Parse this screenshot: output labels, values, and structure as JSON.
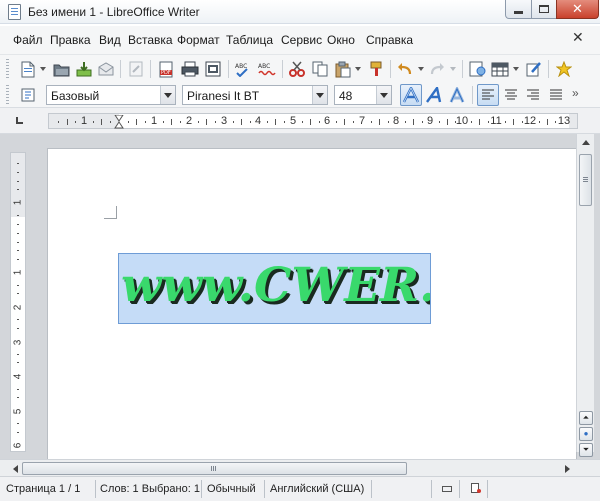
{
  "window": {
    "title": "Без имени 1 - LibreOffice Writer",
    "minimize_icon": "minimize-icon",
    "maximize_icon": "maximize-icon",
    "close_icon": "close-icon"
  },
  "menubar": {
    "items": [
      "Файл",
      "Правка",
      "Вид",
      "Вставка",
      "Формат",
      "Таблица",
      "Сервис",
      "Окно",
      "Справка"
    ],
    "close_doc": "✕"
  },
  "toolbar_standard": {
    "icons": [
      "new-document-icon",
      "open-icon",
      "save-icon",
      "email-icon",
      "edit-file-icon",
      "export-pdf-icon",
      "print-icon",
      "print-preview-icon",
      "spellcheck-icon",
      "autospellcheck-icon",
      "cut-icon",
      "copy-icon",
      "paste-icon",
      "clone-formatting-icon",
      "undo-icon",
      "redo-icon",
      "navigator-icon",
      "table-icon",
      "draw-functions-icon",
      "gallery-icon"
    ]
  },
  "toolbar_formatting": {
    "paragraph_style": "Базовый",
    "font_name": "Piranesi It BT",
    "font_size": "48",
    "icons": [
      "fontwork-outline-icon",
      "fontwork-italic-icon",
      "fontwork-shadow-icon",
      "align-left-icon",
      "align-center-icon",
      "align-right-icon",
      "justify-icon"
    ]
  },
  "ruler": {
    "labels": [
      "1",
      "1",
      "2",
      "3",
      "4",
      "5",
      "6",
      "7",
      "8",
      "9",
      "10",
      "11",
      "12",
      "13"
    ],
    "vlabels": [
      "1",
      "1",
      "2",
      "3",
      "4",
      "5",
      "6"
    ]
  },
  "document": {
    "text": "www.CWER.ws",
    "text_color": "#39d96c",
    "selection_color": "#c5dcf7"
  },
  "scrollbar": {
    "nav_prev": "⏶",
    "nav_select": "●",
    "nav_next": "⏷"
  },
  "statusbar": {
    "page": "Страница 1 / 1",
    "words": "Слов: 1  Выбрано: 1",
    "page_style": "Обычный",
    "language": "Английский (США)"
  }
}
